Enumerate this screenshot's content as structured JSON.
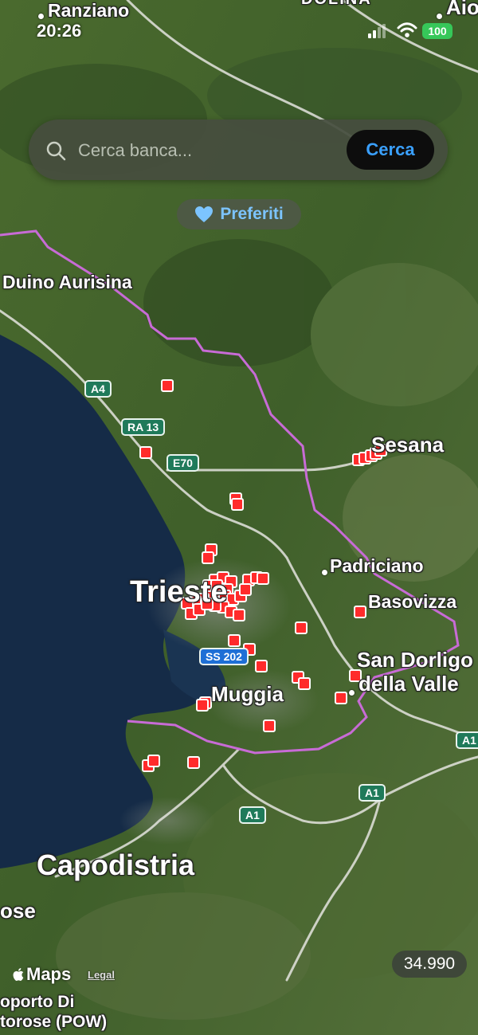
{
  "status_bar": {
    "time": "20:26",
    "battery": "100"
  },
  "search": {
    "placeholder": "Cerca banca...",
    "button_label": "Cerca"
  },
  "favorites": {
    "label": "Preferiti",
    "icon": "heart-icon"
  },
  "map": {
    "labels": {
      "ranziano": "Ranziano",
      "dolina": "DOLINA",
      "aio": "Aio",
      "duino": "Duino Aurisina",
      "sesana": "Sesana",
      "padriciano": "Padriciano",
      "trieste": "Trieste",
      "basovizza": "Basovizza",
      "san_dorligo_1": "San Dorligo",
      "san_dorligo_2": "della Valle",
      "muggia": "Muggia",
      "capodistria": "Capodistria",
      "rose": "ose",
      "aeroporto_1": "oporto Di",
      "aeroporto_2": "torose (POW)"
    },
    "road_shields": {
      "a4": "A4",
      "ra13": "RA 13",
      "e70": "E70",
      "ss202": "SS 202",
      "a1_a": "A1",
      "a1_b": "A1",
      "a1_c": "A1"
    },
    "marker_color": "#ff2b2b",
    "border_color": "#c86bd6"
  },
  "attribution": {
    "brand": "Maps",
    "legal": "Legal"
  },
  "counter": {
    "value": "34.990"
  }
}
